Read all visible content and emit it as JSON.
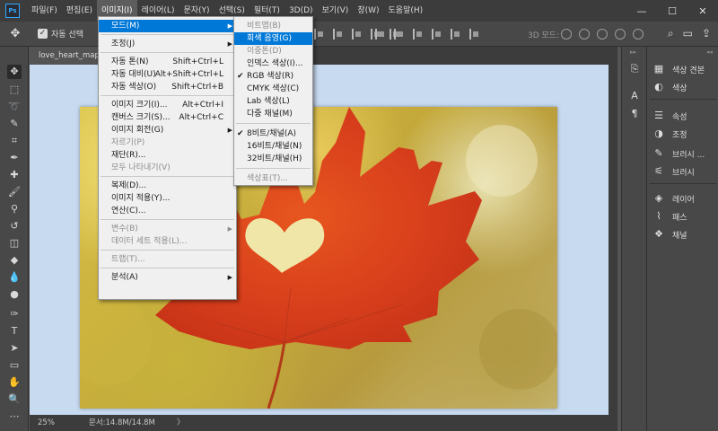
{
  "app": {
    "logo": "Ps"
  },
  "menubar": {
    "items": [
      "파일(F)",
      "편집(E)",
      "이미지(I)",
      "레이어(L)",
      "문자(Y)",
      "선택(S)",
      "필터(T)",
      "3D(D)",
      "보기(V)",
      "창(W)",
      "도움말(H)"
    ],
    "active_index": 2
  },
  "window_controls": {
    "minimize": "—",
    "maximize": "☐",
    "close": "✕"
  },
  "optionsbar": {
    "autoselect_label": "자동 선택",
    "mode3d_label": "3D 모드:"
  },
  "document": {
    "tab_title": "love_heart_maple",
    "zoom": "25%",
    "doc_info": "문서:14.8M/14.8M",
    "status_arrow": "〉"
  },
  "image_menu": {
    "items": [
      {
        "label": "모드(M)",
        "shortcut": "",
        "submenu": true,
        "highlighted": true,
        "disabled": false
      },
      {
        "sep": true
      },
      {
        "label": "조정(J)",
        "shortcut": "",
        "submenu": true,
        "disabled": false
      },
      {
        "sep": true
      },
      {
        "label": "자동 톤(N)",
        "shortcut": "Shift+Ctrl+L",
        "disabled": false
      },
      {
        "label": "자동 대비(U)",
        "shortcut": "Alt+Shift+Ctrl+L",
        "disabled": false
      },
      {
        "label": "자동 색상(O)",
        "shortcut": "Shift+Ctrl+B",
        "disabled": false
      },
      {
        "sep": true
      },
      {
        "label": "이미지 크기(I)...",
        "shortcut": "Alt+Ctrl+I",
        "disabled": false
      },
      {
        "label": "캔버스 크기(S)...",
        "shortcut": "Alt+Ctrl+C",
        "disabled": false
      },
      {
        "label": "이미지 회전(G)",
        "shortcut": "",
        "submenu": true,
        "disabled": false
      },
      {
        "label": "자르기(P)",
        "shortcut": "",
        "disabled": true
      },
      {
        "label": "재단(R)...",
        "shortcut": "",
        "disabled": false
      },
      {
        "label": "모두 나타내기(V)",
        "shortcut": "",
        "disabled": true
      },
      {
        "sep": true
      },
      {
        "label": "복제(D)...",
        "shortcut": "",
        "disabled": false
      },
      {
        "label": "이미지 적용(Y)...",
        "shortcut": "",
        "disabled": false
      },
      {
        "label": "연산(C)...",
        "shortcut": "",
        "disabled": false
      },
      {
        "sep": true
      },
      {
        "label": "변수(B)",
        "shortcut": "",
        "submenu": true,
        "disabled": true
      },
      {
        "label": "데이터 세트 적용(L)...",
        "shortcut": "",
        "disabled": true
      },
      {
        "sep": true
      },
      {
        "label": "트랩(T)...",
        "shortcut": "",
        "disabled": true
      },
      {
        "sep": true
      },
      {
        "label": "분석(A)",
        "shortcut": "",
        "submenu": true,
        "disabled": false
      }
    ]
  },
  "mode_menu": {
    "items": [
      {
        "label": "비트맵(B)",
        "checked": false,
        "disabled": true
      },
      {
        "label": "회색 음영(G)",
        "checked": false,
        "disabled": false,
        "highlighted": true
      },
      {
        "label": "이중톤(D)",
        "checked": false,
        "disabled": true
      },
      {
        "label": "인덱스 색상(I)...",
        "checked": false,
        "disabled": false
      },
      {
        "label": "RGB 색상(R)",
        "checked": true,
        "disabled": false
      },
      {
        "label": "CMYK 색상(C)",
        "checked": false,
        "disabled": false
      },
      {
        "label": "Lab 색상(L)",
        "checked": false,
        "disabled": false
      },
      {
        "label": "다중 채널(M)",
        "checked": false,
        "disabled": false
      },
      {
        "sep": true
      },
      {
        "label": "8비트/채널(A)",
        "checked": true,
        "disabled": false
      },
      {
        "label": "16비트/채널(N)",
        "checked": false,
        "disabled": false
      },
      {
        "label": "32비트/채널(H)",
        "checked": false,
        "disabled": false
      },
      {
        "sep": true
      },
      {
        "label": "색상표(T)...",
        "checked": false,
        "disabled": true
      }
    ],
    "check_glyph": "✔"
  },
  "panels": {
    "narrow_icons": [
      "history-icon",
      "character-icon",
      "paragraph-icon"
    ],
    "wide": [
      {
        "label": "색상 견본",
        "icon": "swatches-icon"
      },
      {
        "label": "색상",
        "icon": "color-icon"
      },
      {
        "sep": true
      },
      {
        "label": "속성",
        "icon": "properties-icon"
      },
      {
        "label": "조정",
        "icon": "adjustments-icon"
      },
      {
        "label": "브러시 ...",
        "icon": "brush-settings-icon"
      },
      {
        "label": "브러시",
        "icon": "brushes-icon"
      },
      {
        "sep": true
      },
      {
        "label": "레이어",
        "icon": "layers-icon"
      },
      {
        "label": "패스",
        "icon": "paths-icon"
      },
      {
        "label": "채널",
        "icon": "channels-icon"
      }
    ]
  },
  "colors": {
    "highlight": "#0078d7",
    "canvas_bg": "#c7daf0",
    "leaf": "#d9401c"
  }
}
